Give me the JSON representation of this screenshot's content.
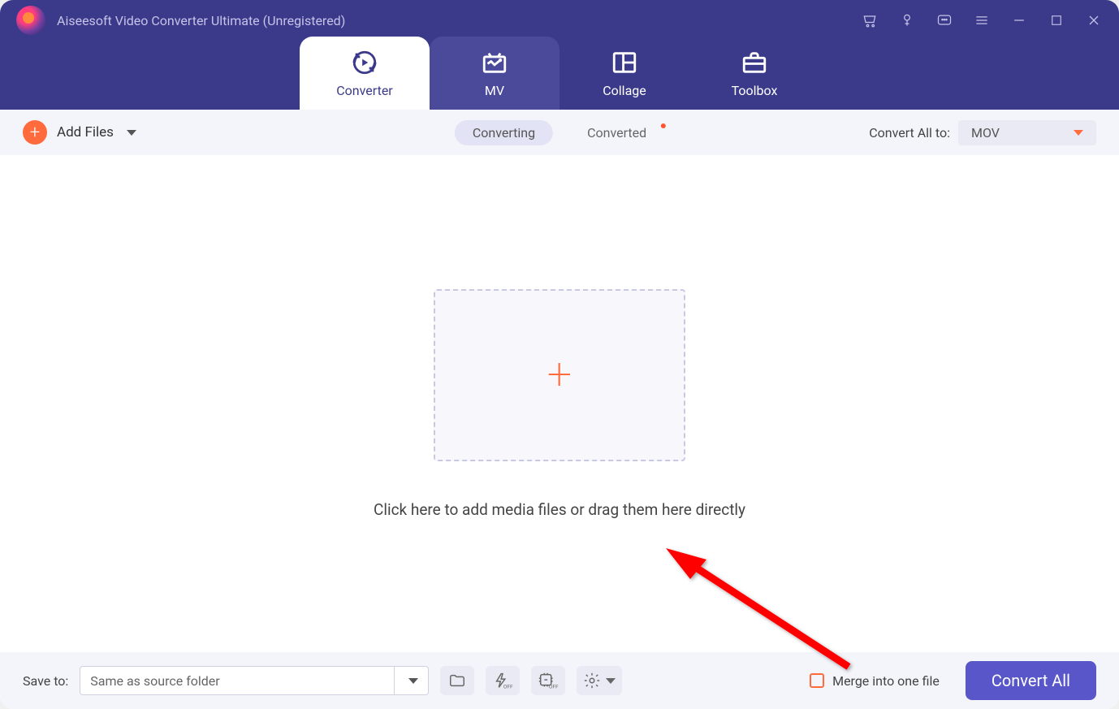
{
  "header": {
    "app_title": "Aiseesoft Video Converter Ultimate (Unregistered)"
  },
  "tabs": {
    "converter": "Converter",
    "mv": "MV",
    "collage": "Collage",
    "toolbox": "Toolbox"
  },
  "toolbar": {
    "add_files": "Add Files",
    "converting": "Converting",
    "converted": "Converted",
    "convert_all_to": "Convert All to:",
    "format_value": "MOV"
  },
  "main": {
    "drop_hint": "Click here to add media files or drag them here directly"
  },
  "footer": {
    "save_to": "Save to:",
    "save_path": "Same as source folder",
    "merge_label": "Merge into one file",
    "convert_btn": "Convert All"
  }
}
